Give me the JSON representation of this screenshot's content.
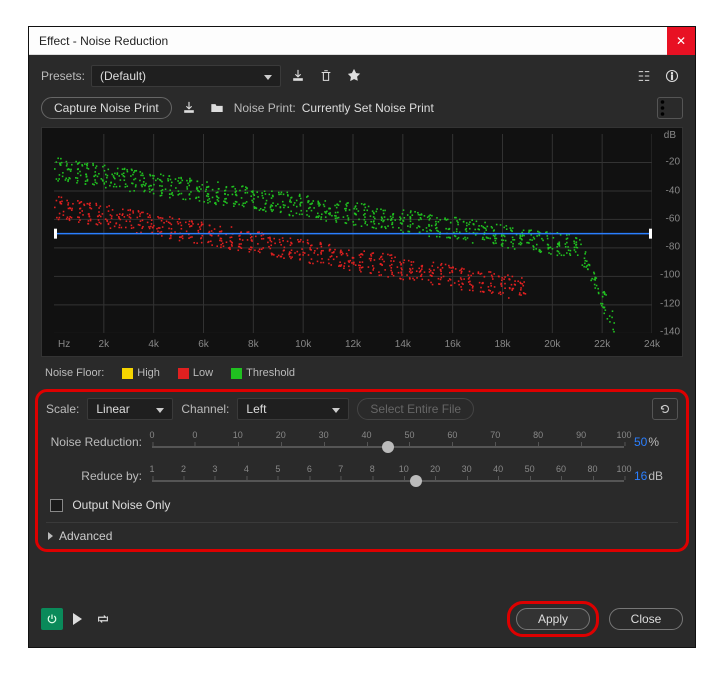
{
  "window": {
    "title": "Effect - Noise Reduction"
  },
  "presets": {
    "label": "Presets:",
    "value": "(Default)"
  },
  "capture": {
    "button": "Capture Noise Print",
    "noise_print_label": "Noise Print:",
    "noise_print_value": "Currently Set Noise Print"
  },
  "legend": {
    "noise_floor_label": "Noise Floor:",
    "high": "High",
    "low": "Low",
    "threshold": "Threshold",
    "colors": {
      "high": "#f5d400",
      "low": "#e02020",
      "threshold": "#20c020"
    }
  },
  "controls": {
    "scale_label": "Scale:",
    "scale_value": "Linear",
    "channel_label": "Channel:",
    "channel_value": "Left",
    "select_entire": "Select Entire File",
    "noise_reduction": {
      "label": "Noise Reduction:",
      "ticks": [
        "0",
        "0",
        "10",
        "20",
        "30",
        "40",
        "50",
        "60",
        "70",
        "80",
        "90",
        "100"
      ],
      "value": "50",
      "unit": "%"
    },
    "reduce_by": {
      "label": "Reduce by:",
      "ticks": [
        "1",
        "2",
        "3",
        "4",
        "5",
        "6",
        "7",
        "8",
        "10",
        "20",
        "30",
        "40",
        "50",
        "60",
        "80",
        "100"
      ],
      "value": "16",
      "unit": "dB"
    },
    "output_noise_only": "Output Noise Only",
    "advanced": "Advanced"
  },
  "footer": {
    "apply": "Apply",
    "close": "Close"
  },
  "chart_data": {
    "type": "scatter",
    "xlabel": "Hz",
    "ylabel": "dB",
    "xlim": [
      0,
      24000
    ],
    "ylim": [
      -140,
      0
    ],
    "x_ticks": [
      2000,
      4000,
      6000,
      8000,
      10000,
      12000,
      14000,
      16000,
      18000,
      20000,
      22000,
      24000
    ],
    "x_tick_labels": [
      "2k",
      "4k",
      "6k",
      "8k",
      "10k",
      "12k",
      "14k",
      "16k",
      "18k",
      "20k",
      "22k",
      "24k"
    ],
    "y_ticks": [
      -20,
      -40,
      -60,
      -80,
      -100,
      -120,
      -140
    ],
    "threshold_line_y": -70,
    "series": [
      {
        "name": "Threshold",
        "color": "#20c020",
        "points": "noise_curve_threshold"
      },
      {
        "name": "Low",
        "color": "#e02020",
        "points": "noise_curve_low"
      }
    ],
    "description": "Green (threshold) curve starts around -20 dB and descends toward -130 dB near 22 kHz with a cliff after 21 kHz. Red (low) curve runs roughly 25-30 dB below green, fading out around 18-20 kHz."
  }
}
